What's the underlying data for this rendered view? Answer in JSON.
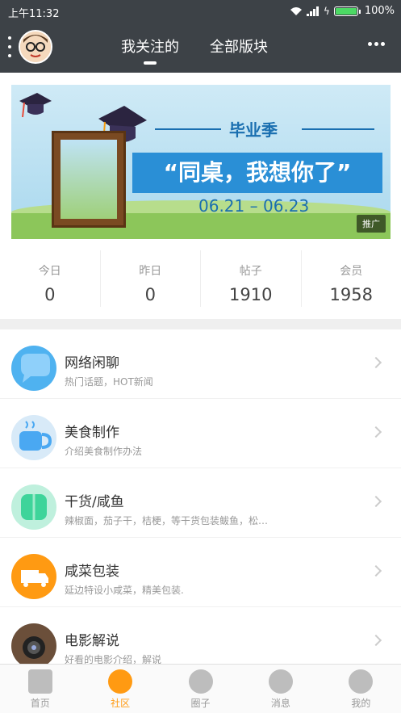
{
  "status": {
    "time": "上午11:32",
    "battery": "100%"
  },
  "nav": {
    "tabs": [
      {
        "label": "我关注的",
        "active": true
      },
      {
        "label": "全部版块",
        "active": false
      }
    ]
  },
  "banner": {
    "title_small": "毕业季",
    "title_big": "“同桌，我想你了”",
    "dates": "06.21 – 06.23",
    "promo": "推广"
  },
  "stats": [
    {
      "label": "今日",
      "value": "0"
    },
    {
      "label": "昨日",
      "value": "0"
    },
    {
      "label": "帖子",
      "value": "1910"
    },
    {
      "label": "会员",
      "value": "1958"
    }
  ],
  "forums": [
    {
      "name": "网络闲聊",
      "desc": "热门话题，HOT新闻",
      "icon": "chat-bubble-icon",
      "color": "#4fb2f0"
    },
    {
      "name": "美食制作",
      "desc": "介绍美食制作办法",
      "icon": "cup-icon",
      "color": "#4aa8f2"
    },
    {
      "name": "干货/咸鱼",
      "desc": "辣椒面，茄子干，桔梗，等干货包装鲅鱼，松…",
      "icon": "book-icon",
      "color": "#3ed49a"
    },
    {
      "name": "咸菜包装",
      "desc": "延边特设小咸菜，精美包装.",
      "icon": "truck-icon",
      "color": "#ff9a12"
    },
    {
      "name": "电影解说",
      "desc": "好看的电影介绍，解说",
      "icon": "camera-icon",
      "color": "#6b4f3a"
    }
  ],
  "bottom_nav": [
    {
      "label": "首页",
      "icon": "home-icon",
      "active": false
    },
    {
      "label": "社区",
      "icon": "community-icon",
      "active": true
    },
    {
      "label": "圈子",
      "icon": "circle-icon",
      "active": false
    },
    {
      "label": "消息",
      "icon": "message-icon",
      "active": false
    },
    {
      "label": "我的",
      "icon": "profile-icon",
      "active": false
    }
  ],
  "colors": {
    "header": "#3d4247",
    "accent": "#ff9a12"
  }
}
